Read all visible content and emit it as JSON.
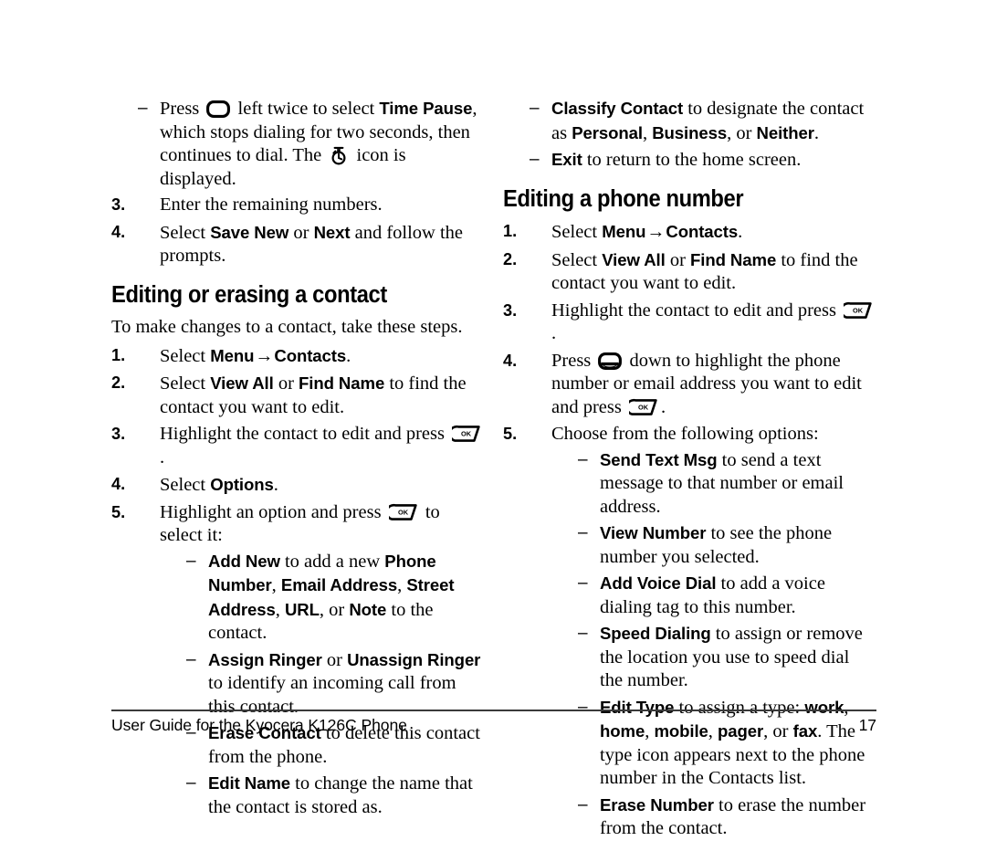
{
  "document": {
    "footer_text": "User Guide for the Kyocera K126C Phone",
    "page_number": "17"
  },
  "icons": {
    "nav_key": "navigation-key-icon",
    "nav_key_down": "navigation-key-down-icon",
    "ok_key": "ok-key-icon",
    "ok_key_label": "OK",
    "timer": "time-pause-timer-icon"
  },
  "left_column": {
    "continued_bullet": {
      "dash": "–",
      "t1": "Press ",
      "t2": " left twice to select ",
      "b1": "Time Pause",
      "t3": ", which stops dialing for two seconds, then continues to dial. The ",
      "t4": " icon is displayed."
    },
    "steps_continued": [
      {
        "num": "3.",
        "text": "Enter the remaining numbers."
      },
      {
        "num": "4.",
        "t1": "Select ",
        "b1": "Save New",
        "t2": " or ",
        "b2": "Next",
        "t3": " and follow the prompts."
      }
    ],
    "heading": "Editing or erasing a contact",
    "intro": "To make changes to a contact, take these steps.",
    "steps": [
      {
        "num": "1.",
        "t1": "Select ",
        "b1": "Menu",
        "arrow": "→",
        "b2": "Contacts",
        "t2": "."
      },
      {
        "num": "2.",
        "t1": "Select ",
        "b1": "View All",
        "t2": " or ",
        "b2": "Find Name",
        "t3": " to find the contact you want to edit."
      },
      {
        "num": "3.",
        "t1": "Highlight the contact to edit and press ",
        "t2": "."
      },
      {
        "num": "4.",
        "t1": "Select ",
        "b1": "Options",
        "t2": "."
      },
      {
        "num": "5.",
        "t1": "Highlight an option and press ",
        "t2": " to select it:"
      }
    ],
    "options": [
      {
        "dash": "–",
        "b1": "Add New",
        "t1": " to add a new ",
        "b2": "Phone Number",
        "t2": ", ",
        "b3": "Email Address",
        "t3": ", ",
        "b4": "Street Address",
        "t4": ", ",
        "b5": "URL",
        "t5": ", or ",
        "b6": "Note",
        "t6": " to the contact."
      },
      {
        "dash": "–",
        "b1": "Assign Ringer",
        "t1": " or ",
        "b2": "Unassign Ringer",
        "t2": " to identify an incoming call from this contact."
      },
      {
        "dash": "–",
        "b1": "Erase Contact",
        "t1": " to delete this contact from the phone."
      },
      {
        "dash": "–",
        "b1": "Edit Name",
        "t1": " to change the name that the contact is stored as."
      }
    ]
  },
  "right_column": {
    "options_continued": [
      {
        "dash": "–",
        "b1": "Classify Contact",
        "t1": " to designate the contact as ",
        "b2": "Personal",
        "t2": ", ",
        "b3": "Business",
        "t3": ", or ",
        "b4": "Neither",
        "t4": "."
      },
      {
        "dash": "–",
        "b1": "Exit",
        "t1": " to return to the home screen."
      }
    ],
    "heading": "Editing a phone number",
    "steps": [
      {
        "num": "1.",
        "t1": "Select ",
        "b1": "Menu",
        "arrow": "→",
        "b2": "Contacts",
        "t2": "."
      },
      {
        "num": "2.",
        "t1": "Select ",
        "b1": "View All",
        "t2": " or ",
        "b2": "Find Name",
        "t3": " to find the contact you want to edit."
      },
      {
        "num": "3.",
        "t1": "Highlight the contact to edit and press ",
        "t2": "."
      },
      {
        "num": "4.",
        "t1": "Press ",
        "t2": " down to highlight the phone number or email address you want to edit and press ",
        "t3": "."
      },
      {
        "num": "5.",
        "t1": "Choose from the following options:"
      }
    ],
    "options": [
      {
        "dash": "–",
        "b1": "Send Text Msg",
        "t1": " to send a text message to that number or email address."
      },
      {
        "dash": "–",
        "b1": "View Number",
        "t1": " to see the phone number you selected."
      },
      {
        "dash": "–",
        "b1": "Add Voice Dial",
        "t1": " to add a voice dialing tag to this number."
      },
      {
        "dash": "–",
        "b1": "Speed Dialing",
        "t1": " to assign or remove the location you use to speed dial the number."
      },
      {
        "dash": "–",
        "b1": "Edit Type",
        "t1": " to assign a type: ",
        "b2": "work",
        "t2": ", ",
        "b3": "home",
        "t3": ", ",
        "b4": "mobile",
        "t4": ", ",
        "b5": "pager",
        "t5": ", or ",
        "b6": "fax",
        "t6": ". The type icon appears next to the phone number in the Contacts list."
      },
      {
        "dash": "–",
        "b1": "Erase Number",
        "t1": " to erase the number from the contact."
      }
    ]
  }
}
